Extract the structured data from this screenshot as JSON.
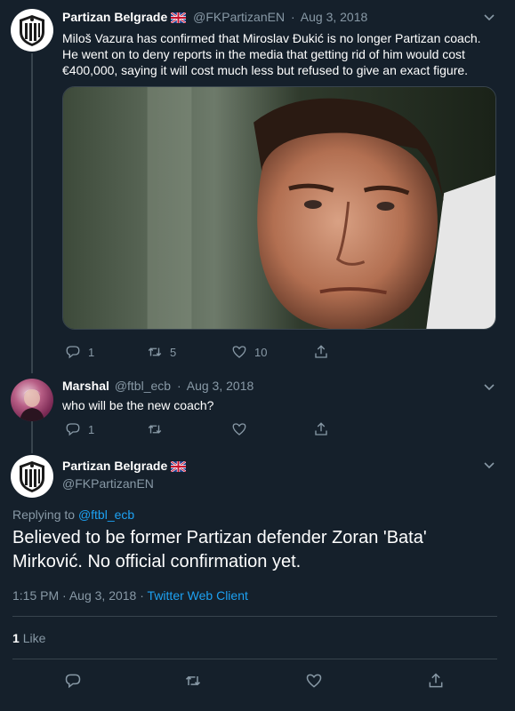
{
  "colors": {
    "background": "#15202b",
    "muted": "#8899a6",
    "link": "#1da1f2",
    "border": "#38444d"
  },
  "tweet1": {
    "name": "Partizan Belgrade",
    "handle": "@FKPartizanEN",
    "separator": "·",
    "date": "Aug 3, 2018",
    "text": "Miloš Vazura has confirmed that Miroslav Đukić is no longer Partizan coach. He went on to deny reports in the media that getting rid of him would cost €400,000, saying it will cost much less but refused to give an exact figure.",
    "reply_count": "1",
    "retweet_count": "5",
    "like_count": "10"
  },
  "tweet2": {
    "name": "Marshal",
    "handle": "@ftbl_ecb",
    "separator": "·",
    "date": "Aug 3, 2018",
    "text": "who will be the new coach?",
    "reply_count": "1"
  },
  "main_tweet": {
    "name": "Partizan Belgrade",
    "handle": "@FKPartizanEN",
    "replying_prefix": "Replying to",
    "replying_to": "@ftbl_ecb",
    "text": "Believed to be former Partizan defender Zoran 'Bata' Mirković. No official confirmation yet.",
    "time": "1:15 PM",
    "separator1": "·",
    "date": "Aug 3, 2018",
    "separator2": "·",
    "client": "Twitter Web Client",
    "likes_count": "1",
    "likes_label": "Like"
  },
  "icons": {
    "reply": "reply-icon",
    "retweet": "retweet-icon",
    "like": "heart-icon",
    "share": "share-icon",
    "menu": "chevron-down-icon",
    "flag": "uk-flag-icon"
  }
}
